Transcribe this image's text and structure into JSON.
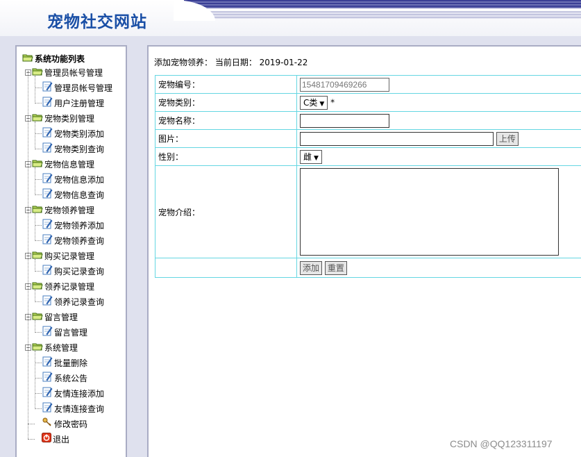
{
  "site": {
    "title": "宠物社交网站"
  },
  "sidebar": {
    "root_label": "系统功能列表",
    "groups": [
      {
        "label": "管理员帐号管理",
        "items": [
          "管理员帐号管理",
          "用户注册管理"
        ]
      },
      {
        "label": "宠物类别管理",
        "items": [
          "宠物类别添加",
          "宠物类别查询"
        ]
      },
      {
        "label": "宠物信息管理",
        "items": [
          "宠物信息添加",
          "宠物信息查询"
        ]
      },
      {
        "label": "宠物领养管理",
        "items": [
          "宠物领养添加",
          "宠物领养查询"
        ]
      },
      {
        "label": "购买记录管理",
        "items": [
          "购买记录查询"
        ]
      },
      {
        "label": "领养记录管理",
        "items": [
          "领养记录查询"
        ]
      },
      {
        "label": "留言管理",
        "items": [
          "留言管理"
        ]
      },
      {
        "label": "系统管理",
        "items": [
          "批量删除",
          "系统公告",
          "友情连接添加",
          "友情连接查询"
        ]
      }
    ],
    "change_password": "修改密码",
    "logout": "退出"
  },
  "main": {
    "breadcrumb": "添加宠物领养： 当前日期： 2019-01-22",
    "form": {
      "pet_id_label": "宠物编号：",
      "pet_id_value": "15481709469266",
      "category_label": "宠物类别：",
      "category_value": "C类",
      "required_mark": "*",
      "name_label": "宠物名称：",
      "name_value": "",
      "image_label": "图片：",
      "image_value": "",
      "upload_label": "上传",
      "gender_label": "性别：",
      "gender_value": "雌",
      "intro_label": "宠物介绍：",
      "intro_value": "",
      "add_label": "添加",
      "reset_label": "重置"
    }
  },
  "watermark": "CSDN @QQ123311197",
  "colors": {
    "title": "#1a4fa6",
    "table_border": "#64d6e2",
    "background": "#dfe1ee"
  },
  "icons": {
    "folder": "folder-open-icon",
    "page": "page-edit-icon",
    "key": "key-icon",
    "power": "power-icon"
  }
}
